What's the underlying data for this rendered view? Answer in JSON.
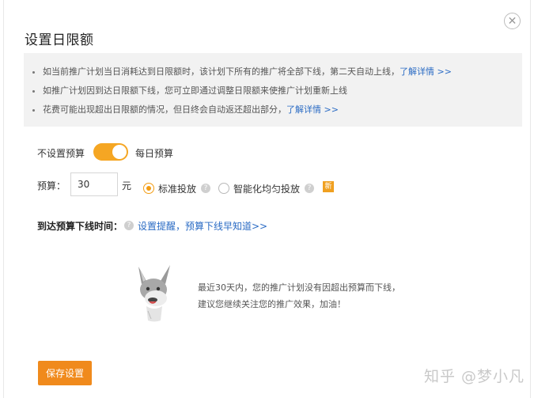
{
  "dialog": {
    "title": "设置日限额",
    "close_symbol": "✕"
  },
  "notice": {
    "items": [
      {
        "text": "如当前推广计划当日消耗达到日限额时，该计划下所有的推广将全部下线，第二天自动上线，",
        "link": "了解详情 >>"
      },
      {
        "text": "如推广计划因到达日限额下线，您可立即通过调整日限额来使推广计划重新上线",
        "link": ""
      },
      {
        "text": "花费可能出现超出日限额的情况，但日终会自动返还超出部分，",
        "link": "了解详情 >>"
      }
    ]
  },
  "budget_switch": {
    "off_label": "不设置预算",
    "on_label": "每日预算",
    "state": "on",
    "color": "#f5a623"
  },
  "budget": {
    "label": "预算：",
    "value": "30",
    "unit": "元"
  },
  "delivery": {
    "options": [
      {
        "label": "标准投放",
        "selected": true,
        "help_icon": "question-circle-icon"
      },
      {
        "label": "智能化均匀投放",
        "selected": false,
        "help_icon": "question-circle-icon"
      }
    ],
    "new_badge": "新",
    "accent_color": "#f39c12"
  },
  "offline_time": {
    "label": "到达预算下线时间：",
    "link": "设置提醒，预算下线早知道>>"
  },
  "empty_state": {
    "icon": "donkey-mascot-icon",
    "line1": "最近30天内，您的推广计划没有因超出预算而下线，",
    "line2": "建议您继续关注您的推广效果，加油！"
  },
  "save_button": {
    "label": "保存设置",
    "color": "#f08a1c"
  },
  "watermark": "知乎 @梦小凡"
}
